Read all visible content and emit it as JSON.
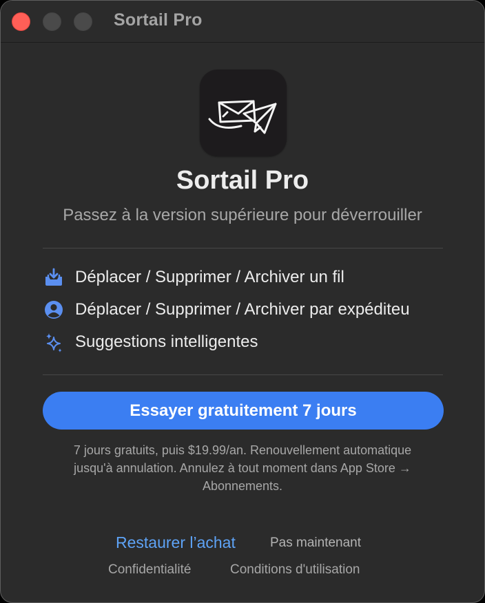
{
  "window": {
    "title": "Sortail Pro"
  },
  "app": {
    "name": "Sortail Pro",
    "icon": "envelope-paper-plane-icon",
    "subtitle": "Passez à la version supérieure pour déverrouiller"
  },
  "features": [
    {
      "icon": "tray-download-icon",
      "label": "Déplacer / Supprimer / Archiver un fil"
    },
    {
      "icon": "person-circle-icon",
      "label": "Déplacer / Supprimer / Archiver par expéditeu"
    },
    {
      "icon": "sparkles-icon",
      "label": "Suggestions intelligentes"
    }
  ],
  "cta": {
    "label": "Essayer gratuitement 7 jours"
  },
  "fine_print": {
    "line1": "7 jours gratuits, puis $19.99/an. Renouvellement automatique",
    "line2": "jusqu'à annulation. Annulez à tout moment dans App Store →",
    "line3": "Abonnements."
  },
  "links": {
    "restore": "Restaurer l’achat",
    "not_now": "Pas maintenant",
    "privacy": "Confidentialité",
    "terms": "Conditions d'utilisation"
  },
  "colors": {
    "accent": "#3b7ef2",
    "link": "#5ea3f6",
    "icon_blue": "#5b8ff0",
    "background": "#2b2b2b",
    "close_button": "#ff5f57"
  }
}
